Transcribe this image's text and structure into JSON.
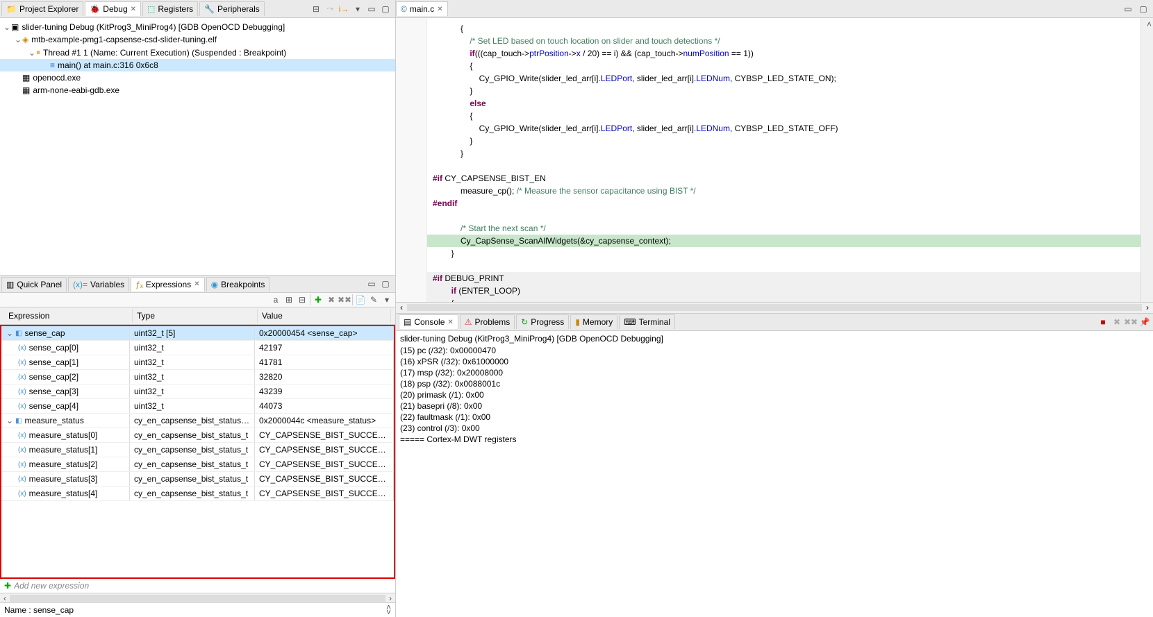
{
  "left": {
    "tabs": {
      "project_explorer": "Project Explorer",
      "debug": "Debug",
      "registers": "Registers",
      "peripherals": "Peripherals"
    },
    "debug_tree": {
      "root": "slider-tuning Debug (KitProg3_MiniProg4) [GDB OpenOCD Debugging]",
      "elf": "mtb-example-pmg1-capsense-csd-slider-tuning.elf",
      "thread": "Thread #1 1 (Name: Current Execution) (Suspended : Breakpoint)",
      "frame": "main() at main.c:316 0x6c8",
      "openocd": "openocd.exe",
      "gdb": "arm-none-eabi-gdb.exe"
    },
    "lower_tabs": {
      "quick_panel": "Quick Panel",
      "variables": "Variables",
      "expressions": "Expressions",
      "breakpoints": "Breakpoints"
    },
    "exp_headers": {
      "expression": "Expression",
      "type": "Type",
      "value": "Value"
    },
    "expressions": [
      {
        "name": "sense_cap",
        "type": "uint32_t [5]",
        "value": "0x20000454 <sense_cap>",
        "parent": true,
        "selected": true
      },
      {
        "name": "sense_cap[0]",
        "type": "uint32_t",
        "value": "42197"
      },
      {
        "name": "sense_cap[1]",
        "type": "uint32_t",
        "value": "41781"
      },
      {
        "name": "sense_cap[2]",
        "type": "uint32_t",
        "value": "32820"
      },
      {
        "name": "sense_cap[3]",
        "type": "uint32_t",
        "value": "43239"
      },
      {
        "name": "sense_cap[4]",
        "type": "uint32_t",
        "value": "44073"
      },
      {
        "name": "measure_status",
        "type": "cy_en_capsense_bist_status_...",
        "value": "0x2000044c <measure_status>",
        "parent": true
      },
      {
        "name": "measure_status[0]",
        "type": "cy_en_capsense_bist_status_t",
        "value": "CY_CAPSENSE_BIST_SUCCESS_E"
      },
      {
        "name": "measure_status[1]",
        "type": "cy_en_capsense_bist_status_t",
        "value": "CY_CAPSENSE_BIST_SUCCESS_E"
      },
      {
        "name": "measure_status[2]",
        "type": "cy_en_capsense_bist_status_t",
        "value": "CY_CAPSENSE_BIST_SUCCESS_E"
      },
      {
        "name": "measure_status[3]",
        "type": "cy_en_capsense_bist_status_t",
        "value": "CY_CAPSENSE_BIST_SUCCESS_E"
      },
      {
        "name": "measure_status[4]",
        "type": "cy_en_capsense_bist_status_t",
        "value": "CY_CAPSENSE_BIST_SUCCESS_E"
      }
    ],
    "add_new": "Add new expression",
    "detail": "Name : sense_cap"
  },
  "editor": {
    "tab": "main.c"
  },
  "console": {
    "tabs": {
      "console": "Console",
      "problems": "Problems",
      "progress": "Progress",
      "memory": "Memory",
      "terminal": "Terminal"
    },
    "title": "slider-tuning Debug (KitProg3_MiniProg4) [GDB OpenOCD Debugging]",
    "lines": [
      "(15) pc (/32): 0x00000470",
      "(16) xPSR (/32): 0x61000000",
      "(17) msp (/32): 0x20008000",
      "(18) psp (/32): 0x0088001c",
      "(20) primask (/1): 0x00",
      "(21) basepri (/8): 0x00",
      "(22) faultmask (/1): 0x00",
      "(23) control (/3): 0x00",
      "===== Cortex-M DWT registers"
    ]
  }
}
